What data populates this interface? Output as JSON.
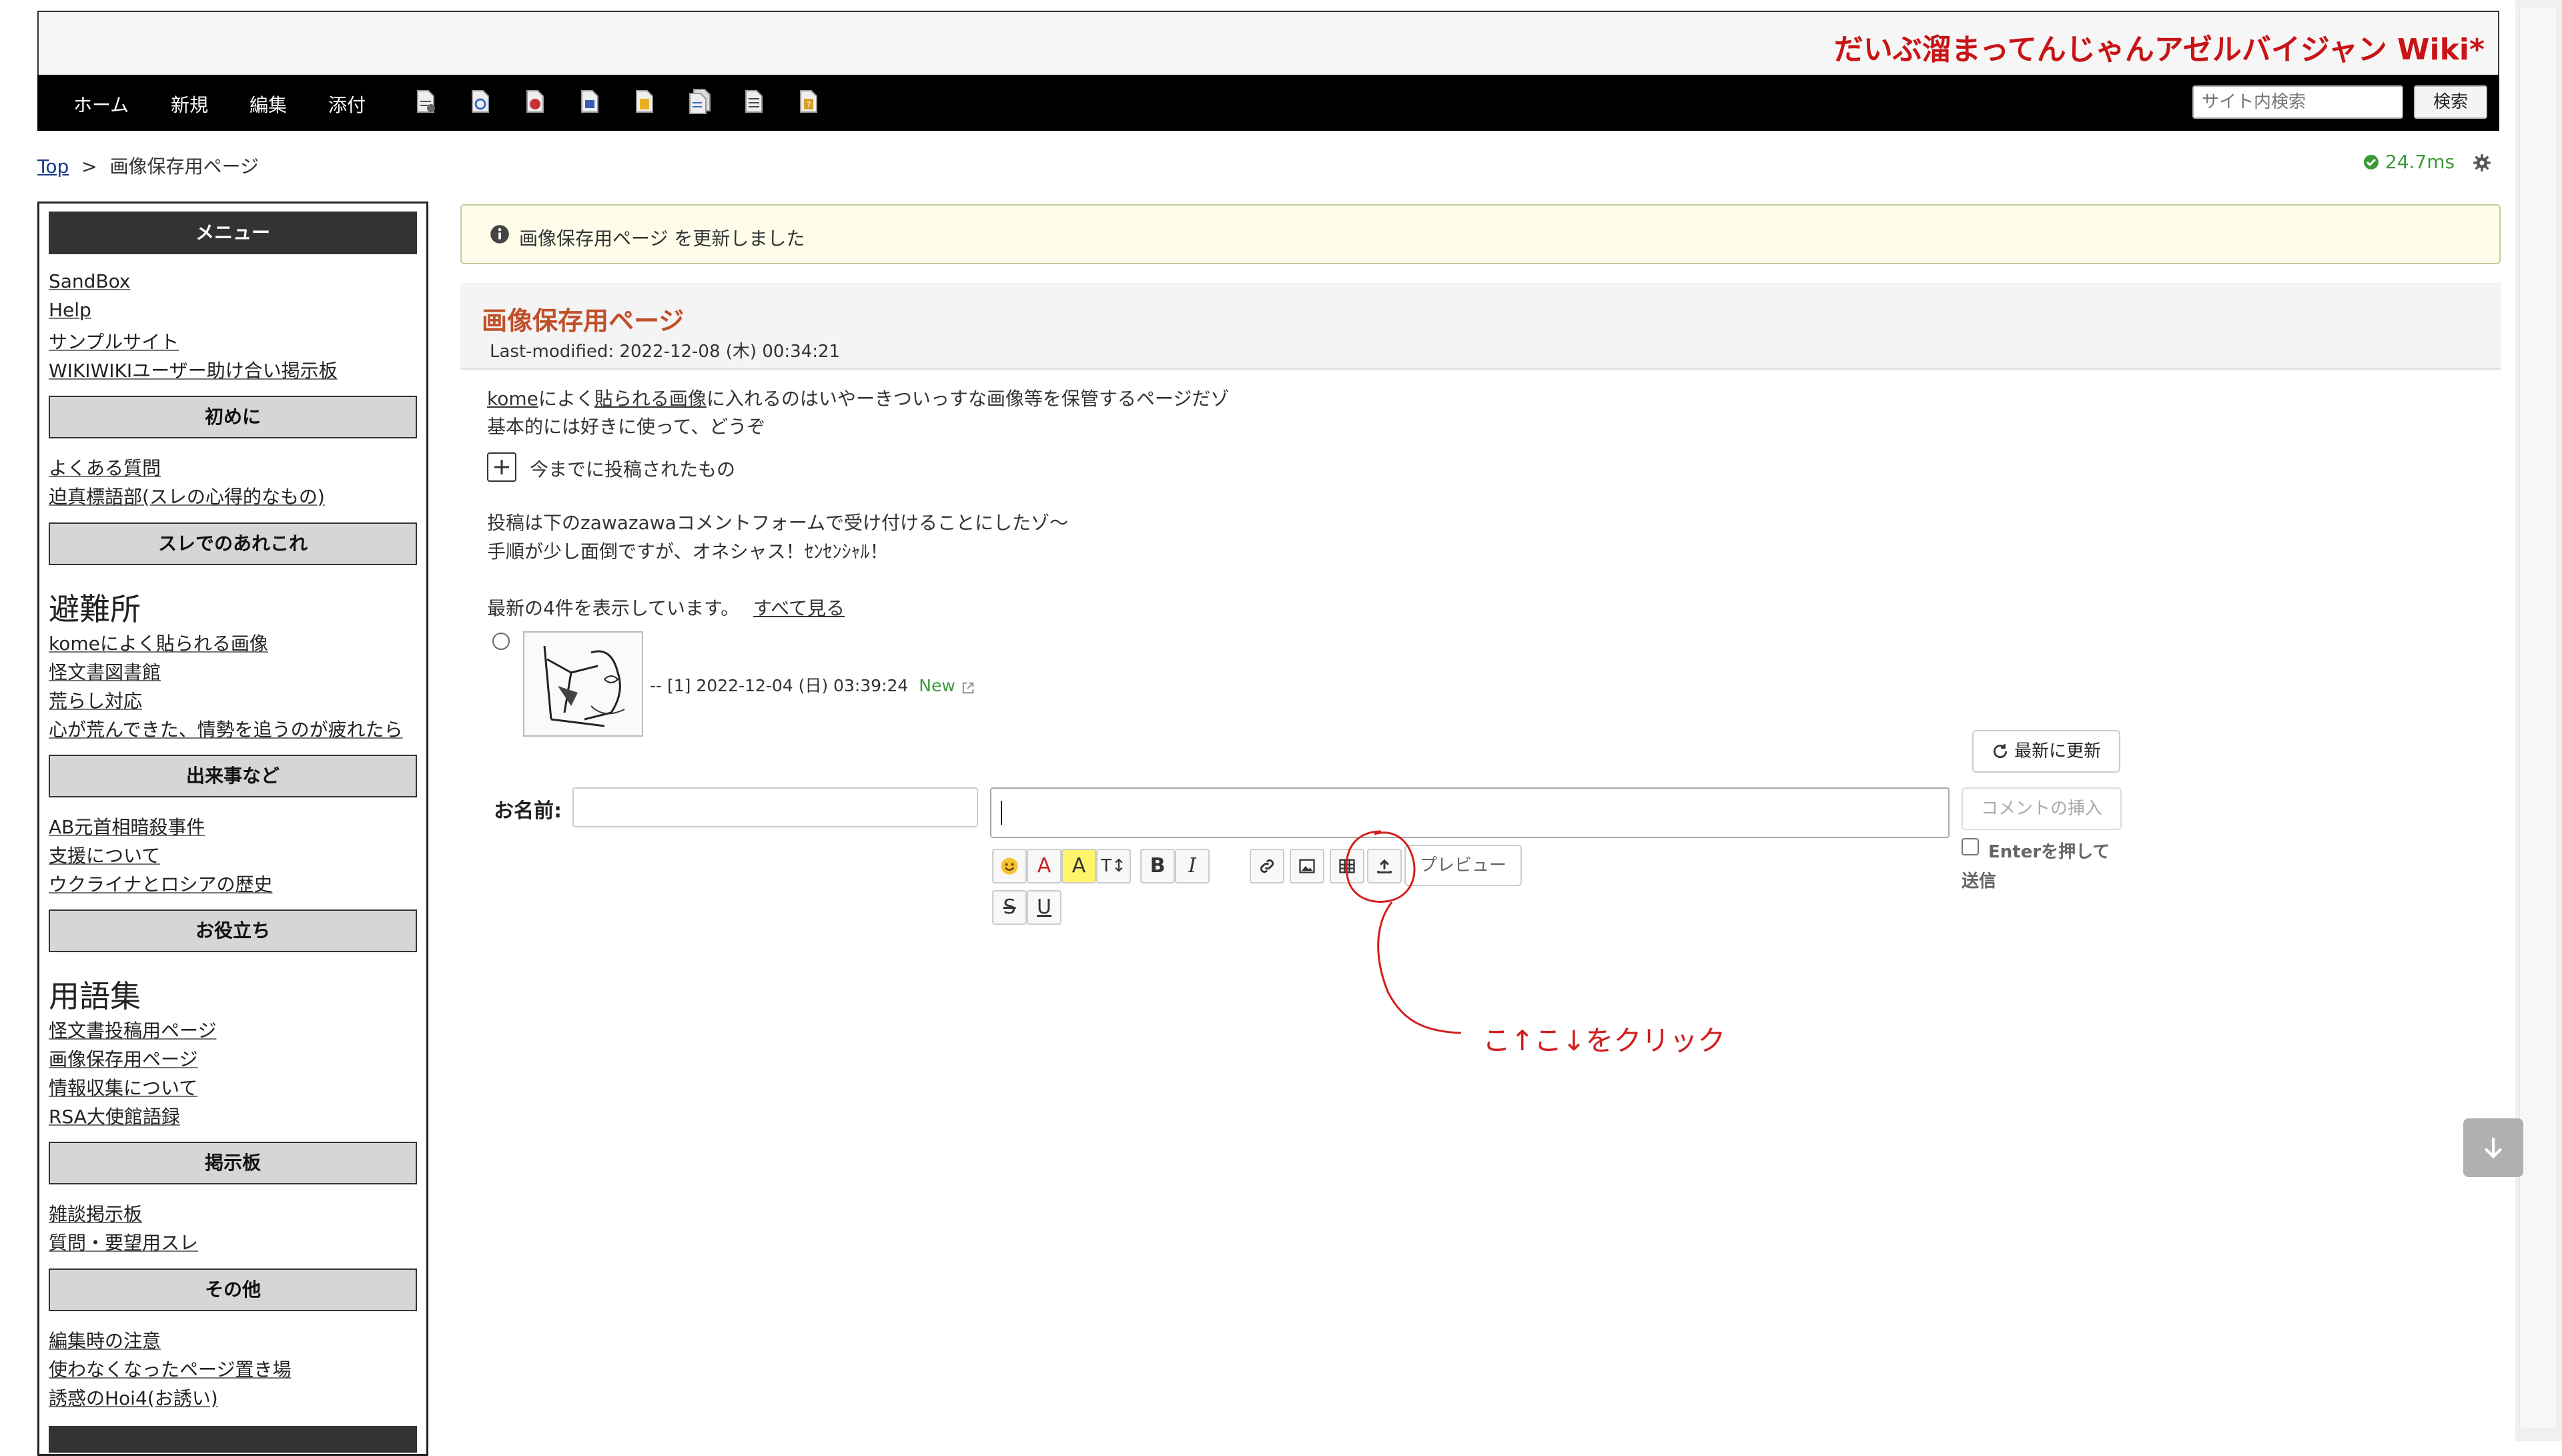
{
  "header": {
    "site_title": "だいぶ溜まってんじゃんアゼルバイジャン Wiki*"
  },
  "nav": {
    "items": [
      "ホーム",
      "新規",
      "編集",
      "添付"
    ]
  },
  "search": {
    "placeholder": "サイト内検索",
    "button": "検索"
  },
  "breadcrumb": {
    "top": "Top",
    "separator": ">",
    "current": "画像保存用ページ"
  },
  "timing": "24.7ms",
  "sidebar": {
    "menu_title": "メニュー",
    "menu_links": [
      "SandBox",
      "Help",
      "サンプルサイト",
      "WIKIWIKIユーザー助け合い掲示板"
    ],
    "section_beginner": "初めに",
    "beginner_links": [
      "よくある質問",
      "迫真標語部(スレの心得的なもの)"
    ],
    "section_thread": "スレでのあれこれ",
    "refuge_heading": "避難所",
    "refuge_links": [
      "komeによく貼られる画像",
      "怪文書図書館",
      "荒らし対応",
      "心が荒んできた、情勢を追うのが疲れたら"
    ],
    "section_events": "出来事など",
    "events_links": [
      "AB元首相暗殺事件",
      "支援について",
      "ウクライナとロシアの歴史"
    ],
    "section_useful": "お役立ち",
    "glossary_heading": "用語集",
    "useful_links": [
      "怪文書投稿用ページ",
      "画像保存用ページ",
      "情報収集について",
      "RSA大使館語録"
    ],
    "section_board": "掲示板",
    "board_links": [
      "雑談掲示板",
      "質問・要望用スレ"
    ],
    "section_other": "その他",
    "other_links": [
      "編集時の注意",
      "使わなくなったページ置き場",
      "誘惑のHoi4(お誘い)"
    ]
  },
  "notice": {
    "page": "画像保存用ページ",
    "text": " を更新しました"
  },
  "page": {
    "title": "画像保存用ページ",
    "last_modified": "Last-modified: 2022-12-08 (木) 00:34:21",
    "intro_link": "kome",
    "intro_mid": "によく",
    "intro_link2": "貼られる画像",
    "intro_rest": "に入れるのはいやーきついっすな画像等を保管するページだゾ",
    "intro_line2": "基本的には好きに使って、どうぞ",
    "expand_label": "今までに投稿されたもの",
    "post_line1": "投稿は下のzawazawaコメントフォームで受け付けることにしたゾ〜",
    "post_line2": "手順が少し面倒ですが、オネシャス！ｾﾝｾﾝｼｬﾙ！"
  },
  "comments": {
    "summary": "最新の4件を表示しています。",
    "see_all": "すべて見る",
    "entry_meta": "-- [1] 2022-12-04 (日) 03:39:24",
    "entry_new": "New"
  },
  "form": {
    "refresh_label": "最新に更新",
    "name_label": "お名前:",
    "insert_label": "コメントの挿入",
    "enter_label": "Enterを押して",
    "enter_label2": "送信",
    "preview_label": "プレビュー"
  },
  "annotation": {
    "text": "こ↑こ↓をクリック",
    "color": "#d21e1e"
  },
  "colors": {
    "title_red": "#c81414",
    "nav_bg": "#000000",
    "timing_green": "#3a9a3a",
    "page_title": "#c0502a"
  }
}
